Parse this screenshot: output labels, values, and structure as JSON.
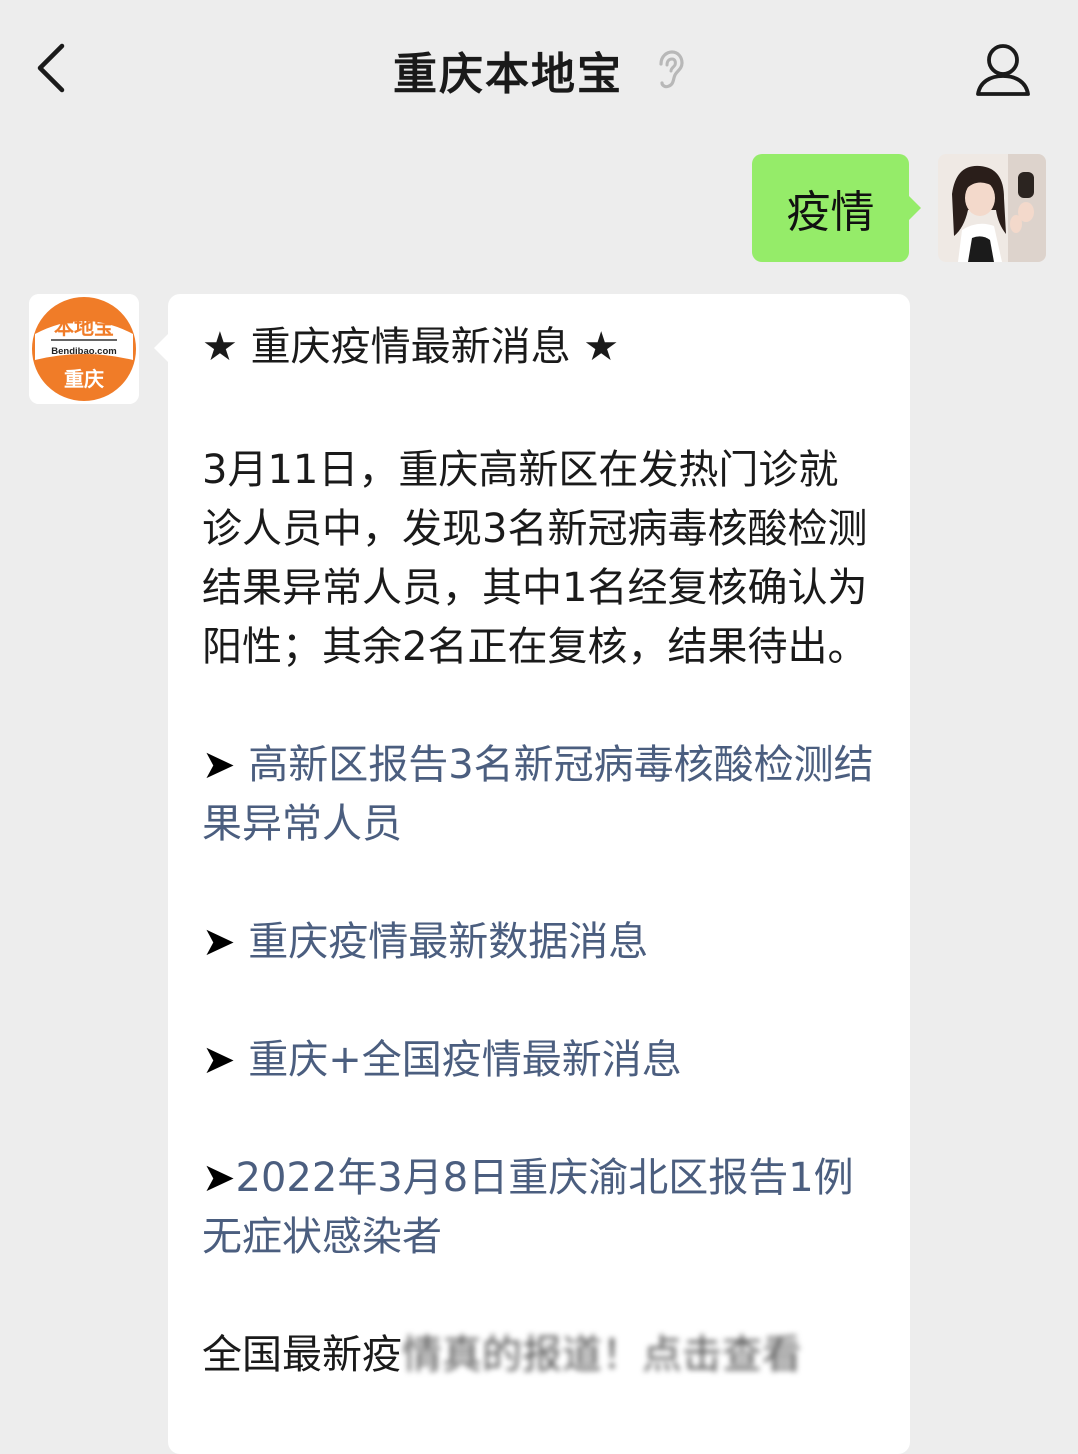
{
  "header": {
    "title": "重庆本地宝"
  },
  "outgoing": {
    "text": "疫情"
  },
  "bot": {
    "logo_top": "本地宝",
    "logo_domain": "Bendibao.com",
    "logo_city": "重庆"
  },
  "message": {
    "title": "★ 重庆疫情最新消息 ★",
    "body": "3月11日，重庆高新区在发热门诊就诊人员中，发现3名新冠病毒核酸检测结果异常人员，其中1名经复核确认为阳性；其余2名正在复核，结果待出。",
    "links": [
      "高新区报告3名新冠病毒核酸检测结果异常人员",
      "重庆疫情最新数据消息",
      "重庆+全国疫情最新消息",
      "2022年3月8日重庆渝北区报告1例无症状感染者"
    ],
    "arrow": "➤",
    "tail_visible": "全国最新疫",
    "tail_blurred": "情真的报道！点击查看"
  },
  "colors": {
    "background": "#ededed",
    "outgoing_bubble": "#95ec69",
    "incoming_bubble": "#ffffff",
    "link": "#4b5e7f",
    "logo_orange": "#f07c28"
  },
  "icons": {
    "back": "chevron-left-icon",
    "title_badge": "ear-icon",
    "profile": "user-icon"
  }
}
